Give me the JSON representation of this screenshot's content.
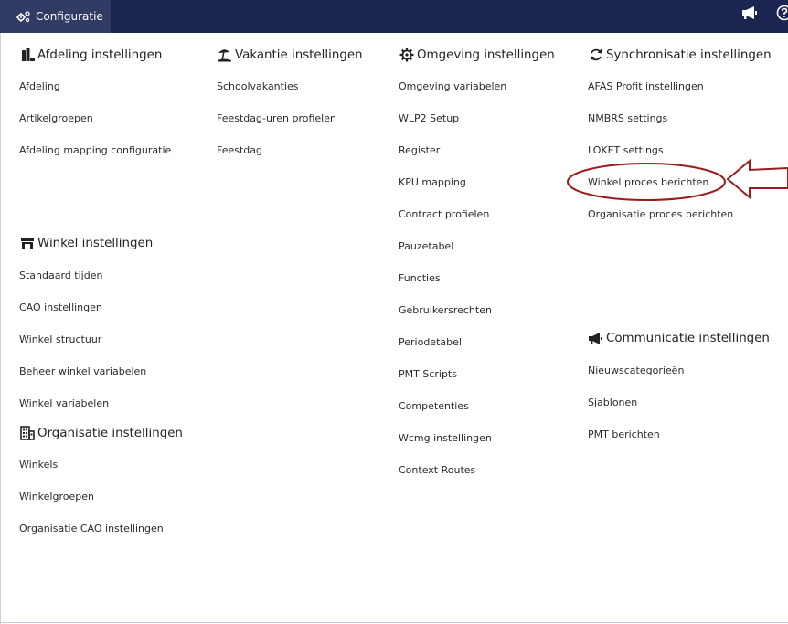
{
  "topbar": {
    "tab_label": "Configuratie",
    "icons": [
      "gears-icon",
      "megaphone-icon",
      "help-icon"
    ]
  },
  "columns": {
    "afdeling": {
      "title": "Afdeling instellingen",
      "icon": "books-icon",
      "links": [
        "Afdeling",
        "Artikelgroepen",
        "Afdeling mapping configuratie"
      ]
    },
    "winkel": {
      "title": "Winkel instellingen",
      "icon": "store-icon",
      "links": [
        "Standaard tijden",
        "CAO instellingen",
        "Winkel structuur",
        "Beheer winkel variabelen",
        "Winkel variabelen"
      ]
    },
    "organisatie": {
      "title": "Organisatie instellingen",
      "icon": "building-icon",
      "links": [
        "Winkels",
        "Winkelgroepen",
        "Organisatie CAO instellingen"
      ]
    },
    "vakantie": {
      "title": "Vakantie instellingen",
      "icon": "beach-icon",
      "links": [
        "Schoolvakanties",
        "Feestdag-uren profielen",
        "Feestdag"
      ]
    },
    "omgeving": {
      "title": "Omgeving instellingen",
      "icon": "gear-icon",
      "links": [
        "Omgeving variabelen",
        "WLP2 Setup",
        "Register",
        "KPU mapping",
        "Contract profielen",
        "Pauzetabel",
        "Functies",
        "Gebruikersrechten",
        "Periodetabel",
        "PMT Scripts",
        "Competenties",
        "Wcmg instellingen",
        "Context Routes"
      ]
    },
    "synchronisatie": {
      "title": "Synchronisatie instellingen",
      "icon": "sync-icon",
      "links": [
        "AFAS Profit instellingen",
        "NMBRS settings",
        "LOKET settings",
        "Winkel proces berichten",
        "Organisatie proces berichten"
      ]
    },
    "communicatie": {
      "title": "Communicatie instellingen",
      "icon": "megaphone-icon",
      "links": [
        "Nieuwscategorieën",
        "Sjablonen",
        "PMT berichten"
      ]
    }
  },
  "annotation": {
    "color": "#9a1c1c"
  }
}
